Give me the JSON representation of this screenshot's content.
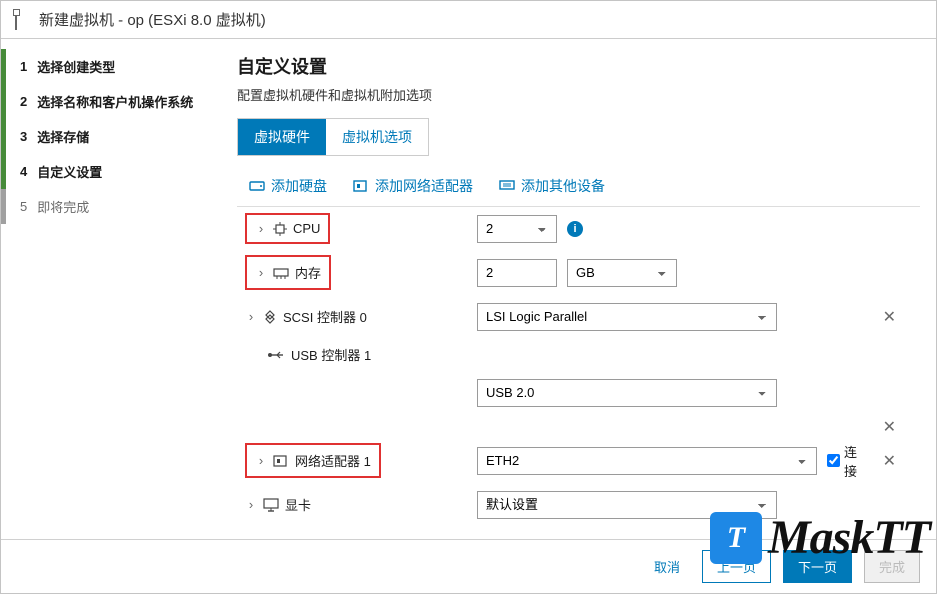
{
  "title": "新建虚拟机 - op (ESXi 8.0 虚拟机)",
  "steps": [
    {
      "num": "1",
      "label": "选择创建类型"
    },
    {
      "num": "2",
      "label": "选择名称和客户机操作系统"
    },
    {
      "num": "3",
      "label": "选择存储"
    },
    {
      "num": "4",
      "label": "自定义设置"
    },
    {
      "num": "5",
      "label": "即将完成"
    }
  ],
  "main": {
    "heading": "自定义设置",
    "desc": "配置虚拟机硬件和虚拟机附加选项",
    "tabs": {
      "hw": "虚拟硬件",
      "opts": "虚拟机选项"
    },
    "toolbar": {
      "add_disk": "添加硬盘",
      "add_nic": "添加网络适配器",
      "add_other": "添加其他设备"
    },
    "rows": {
      "cpu": {
        "label": "CPU",
        "value": "2"
      },
      "mem": {
        "label": "内存",
        "value": "2",
        "unit": "GB"
      },
      "scsi": {
        "label": "SCSI 控制器 0",
        "value": "LSI Logic Parallel"
      },
      "usb_ctrl": {
        "label": "USB 控制器 1"
      },
      "usb": {
        "value": "USB 2.0"
      },
      "nic": {
        "label": "网络适配器 1",
        "value": "ETH2",
        "connect": "连接"
      },
      "gpu": {
        "label": "显卡",
        "value": "默认设置"
      }
    }
  },
  "footer": {
    "cancel": "取消",
    "back": "上一页",
    "next": "下一页",
    "finish": "完成"
  },
  "watermark": "MaskTT",
  "info_glyph": "i"
}
